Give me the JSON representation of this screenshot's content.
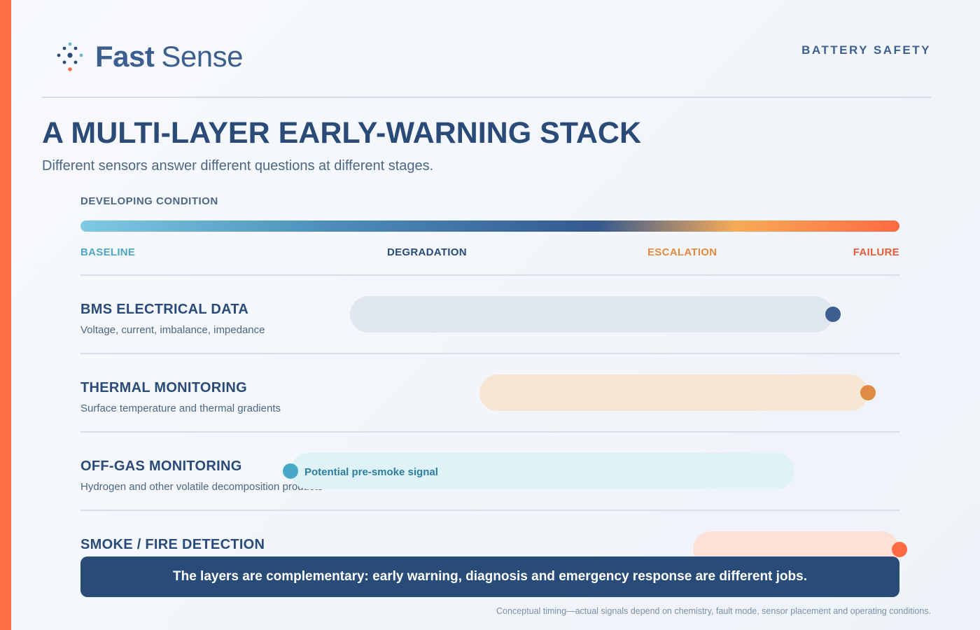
{
  "brand": {
    "name_bold": "Fast",
    "name_light": "Sense",
    "icon": "dotted-sensor-logo-icon",
    "accent_color": "#ff6f45"
  },
  "header": {
    "topic": "BATTERY SAFETY"
  },
  "title": "A MULTI-LAYER EARLY-WARNING STACK",
  "subtitle": "Different sensors answer different questions at different stages.",
  "axis": {
    "label": "DEVELOPING CONDITION",
    "stages": [
      "BASELINE",
      "DEGRADATION",
      "ESCALATION",
      "FAILURE"
    ],
    "stage_colors": [
      "#4fa6c4",
      "#2a4a78",
      "#e3893f",
      "#e35d3c"
    ]
  },
  "layers": [
    {
      "title": "BMS ELECTRICAL DATA",
      "desc": "Voltage, current, imbalance, impedance",
      "color": "#3d5f8f"
    },
    {
      "title": "THERMAL MONITORING",
      "desc": "Surface temperature and thermal gradients",
      "color": "#e08b45"
    },
    {
      "title": "OFF-GAS MONITORING",
      "desc": "Hydrogen and other volatile decomposition products",
      "band_label": "Potential pre-smoke signal",
      "color": "#48a8c8"
    },
    {
      "title": "SMOKE / FIRE DETECTION",
      "color": "#ff6a42"
    }
  ],
  "callout": "The layers are complementary: early warning, diagnosis and emergency response are different jobs.",
  "footnote": "Conceptual timing—actual signals depend on chemistry, fault mode, sensor placement and operating conditions."
}
